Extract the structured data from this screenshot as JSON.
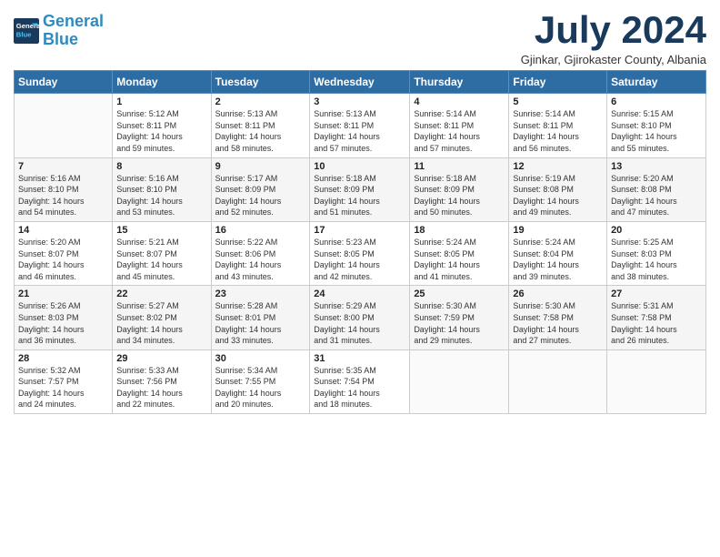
{
  "header": {
    "logo_line1": "General",
    "logo_line2": "Blue",
    "title": "July 2024",
    "subtitle": "Gjinkar, Gjirokaster County, Albania"
  },
  "days_of_week": [
    "Sunday",
    "Monday",
    "Tuesday",
    "Wednesday",
    "Thursday",
    "Friday",
    "Saturday"
  ],
  "weeks": [
    [
      {
        "day": "",
        "info": ""
      },
      {
        "day": "1",
        "info": "Sunrise: 5:12 AM\nSunset: 8:11 PM\nDaylight: 14 hours\nand 59 minutes."
      },
      {
        "day": "2",
        "info": "Sunrise: 5:13 AM\nSunset: 8:11 PM\nDaylight: 14 hours\nand 58 minutes."
      },
      {
        "day": "3",
        "info": "Sunrise: 5:13 AM\nSunset: 8:11 PM\nDaylight: 14 hours\nand 57 minutes."
      },
      {
        "day": "4",
        "info": "Sunrise: 5:14 AM\nSunset: 8:11 PM\nDaylight: 14 hours\nand 57 minutes."
      },
      {
        "day": "5",
        "info": "Sunrise: 5:14 AM\nSunset: 8:11 PM\nDaylight: 14 hours\nand 56 minutes."
      },
      {
        "day": "6",
        "info": "Sunrise: 5:15 AM\nSunset: 8:10 PM\nDaylight: 14 hours\nand 55 minutes."
      }
    ],
    [
      {
        "day": "7",
        "info": "Sunrise: 5:16 AM\nSunset: 8:10 PM\nDaylight: 14 hours\nand 54 minutes."
      },
      {
        "day": "8",
        "info": "Sunrise: 5:16 AM\nSunset: 8:10 PM\nDaylight: 14 hours\nand 53 minutes."
      },
      {
        "day": "9",
        "info": "Sunrise: 5:17 AM\nSunset: 8:09 PM\nDaylight: 14 hours\nand 52 minutes."
      },
      {
        "day": "10",
        "info": "Sunrise: 5:18 AM\nSunset: 8:09 PM\nDaylight: 14 hours\nand 51 minutes."
      },
      {
        "day": "11",
        "info": "Sunrise: 5:18 AM\nSunset: 8:09 PM\nDaylight: 14 hours\nand 50 minutes."
      },
      {
        "day": "12",
        "info": "Sunrise: 5:19 AM\nSunset: 8:08 PM\nDaylight: 14 hours\nand 49 minutes."
      },
      {
        "day": "13",
        "info": "Sunrise: 5:20 AM\nSunset: 8:08 PM\nDaylight: 14 hours\nand 47 minutes."
      }
    ],
    [
      {
        "day": "14",
        "info": "Sunrise: 5:20 AM\nSunset: 8:07 PM\nDaylight: 14 hours\nand 46 minutes."
      },
      {
        "day": "15",
        "info": "Sunrise: 5:21 AM\nSunset: 8:07 PM\nDaylight: 14 hours\nand 45 minutes."
      },
      {
        "day": "16",
        "info": "Sunrise: 5:22 AM\nSunset: 8:06 PM\nDaylight: 14 hours\nand 43 minutes."
      },
      {
        "day": "17",
        "info": "Sunrise: 5:23 AM\nSunset: 8:05 PM\nDaylight: 14 hours\nand 42 minutes."
      },
      {
        "day": "18",
        "info": "Sunrise: 5:24 AM\nSunset: 8:05 PM\nDaylight: 14 hours\nand 41 minutes."
      },
      {
        "day": "19",
        "info": "Sunrise: 5:24 AM\nSunset: 8:04 PM\nDaylight: 14 hours\nand 39 minutes."
      },
      {
        "day": "20",
        "info": "Sunrise: 5:25 AM\nSunset: 8:03 PM\nDaylight: 14 hours\nand 38 minutes."
      }
    ],
    [
      {
        "day": "21",
        "info": "Sunrise: 5:26 AM\nSunset: 8:03 PM\nDaylight: 14 hours\nand 36 minutes."
      },
      {
        "day": "22",
        "info": "Sunrise: 5:27 AM\nSunset: 8:02 PM\nDaylight: 14 hours\nand 34 minutes."
      },
      {
        "day": "23",
        "info": "Sunrise: 5:28 AM\nSunset: 8:01 PM\nDaylight: 14 hours\nand 33 minutes."
      },
      {
        "day": "24",
        "info": "Sunrise: 5:29 AM\nSunset: 8:00 PM\nDaylight: 14 hours\nand 31 minutes."
      },
      {
        "day": "25",
        "info": "Sunrise: 5:30 AM\nSunset: 7:59 PM\nDaylight: 14 hours\nand 29 minutes."
      },
      {
        "day": "26",
        "info": "Sunrise: 5:30 AM\nSunset: 7:58 PM\nDaylight: 14 hours\nand 27 minutes."
      },
      {
        "day": "27",
        "info": "Sunrise: 5:31 AM\nSunset: 7:58 PM\nDaylight: 14 hours\nand 26 minutes."
      }
    ],
    [
      {
        "day": "28",
        "info": "Sunrise: 5:32 AM\nSunset: 7:57 PM\nDaylight: 14 hours\nand 24 minutes."
      },
      {
        "day": "29",
        "info": "Sunrise: 5:33 AM\nSunset: 7:56 PM\nDaylight: 14 hours\nand 22 minutes."
      },
      {
        "day": "30",
        "info": "Sunrise: 5:34 AM\nSunset: 7:55 PM\nDaylight: 14 hours\nand 20 minutes."
      },
      {
        "day": "31",
        "info": "Sunrise: 5:35 AM\nSunset: 7:54 PM\nDaylight: 14 hours\nand 18 minutes."
      },
      {
        "day": "",
        "info": ""
      },
      {
        "day": "",
        "info": ""
      },
      {
        "day": "",
        "info": ""
      }
    ]
  ]
}
